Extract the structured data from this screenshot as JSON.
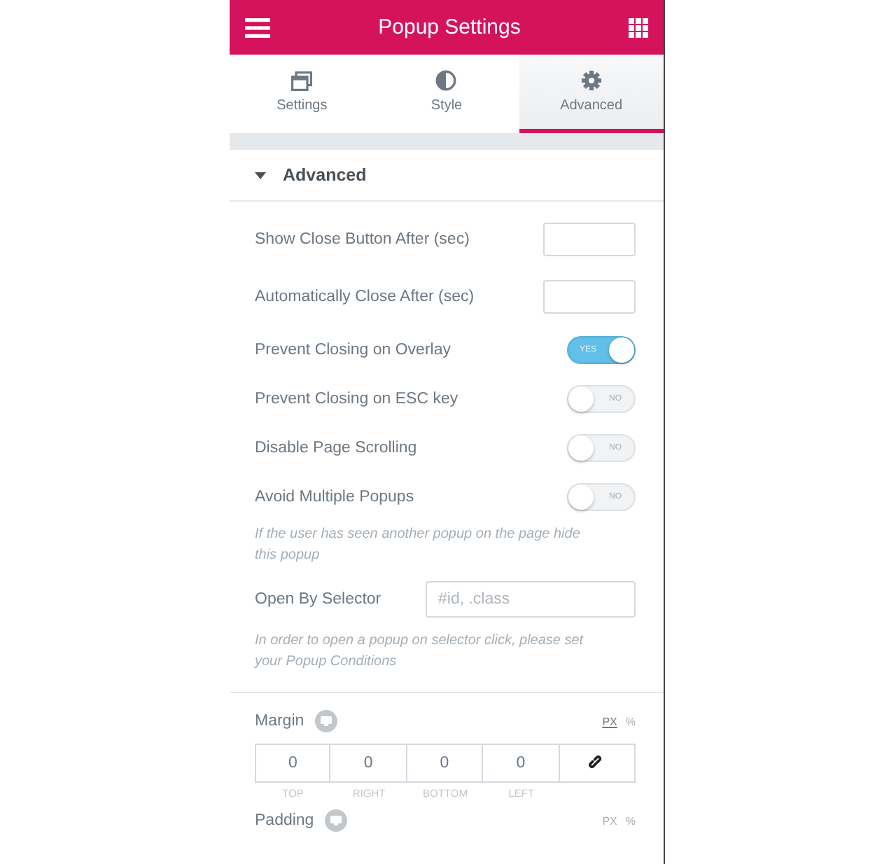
{
  "header": {
    "title": "Popup Settings"
  },
  "tabs": [
    {
      "label": "Settings",
      "selected": false
    },
    {
      "label": "Style",
      "selected": false
    },
    {
      "label": "Advanced",
      "selected": true
    }
  ],
  "section": {
    "title": "Advanced",
    "expanded": true
  },
  "controls": [
    {
      "kind": "number",
      "label": "Show Close Button After (sec)"
    },
    {
      "kind": "number",
      "label": "Automatically Close After (sec)"
    },
    {
      "kind": "switch",
      "label": "Prevent Closing on Overlay",
      "on": true,
      "text": "YES"
    },
    {
      "kind": "switch",
      "label": "Prevent Closing on ESC key",
      "on": false,
      "text": "NO"
    },
    {
      "kind": "switch",
      "label": "Disable Page Scrolling",
      "on": false,
      "text": "NO"
    },
    {
      "kind": "switch",
      "label": "Avoid Multiple Popups",
      "on": false,
      "text": "NO"
    },
    {
      "kind": "note",
      "text": "If the user has seen another popup on the page hide this popup"
    },
    {
      "kind": "text",
      "label": "Open By Selector",
      "placeholder": "#id, .class"
    },
    {
      "kind": "note",
      "text": "In order to open a popup on selector click, please set your Popup Conditions"
    }
  ],
  "margin": {
    "label": "Margin",
    "units": [
      {
        "label": "PX",
        "selected": true
      },
      {
        "label": "%",
        "selected": false
      }
    ],
    "fields": [
      {
        "value": "0",
        "caption": "TOP"
      },
      {
        "value": "0",
        "caption": "RIGHT"
      },
      {
        "value": "0",
        "caption": "BOTTOM"
      },
      {
        "value": "0",
        "caption": "LEFT"
      }
    ]
  },
  "padding": {
    "label": "Padding",
    "units": [
      {
        "label": "PX"
      },
      {
        "label": "%"
      }
    ]
  }
}
